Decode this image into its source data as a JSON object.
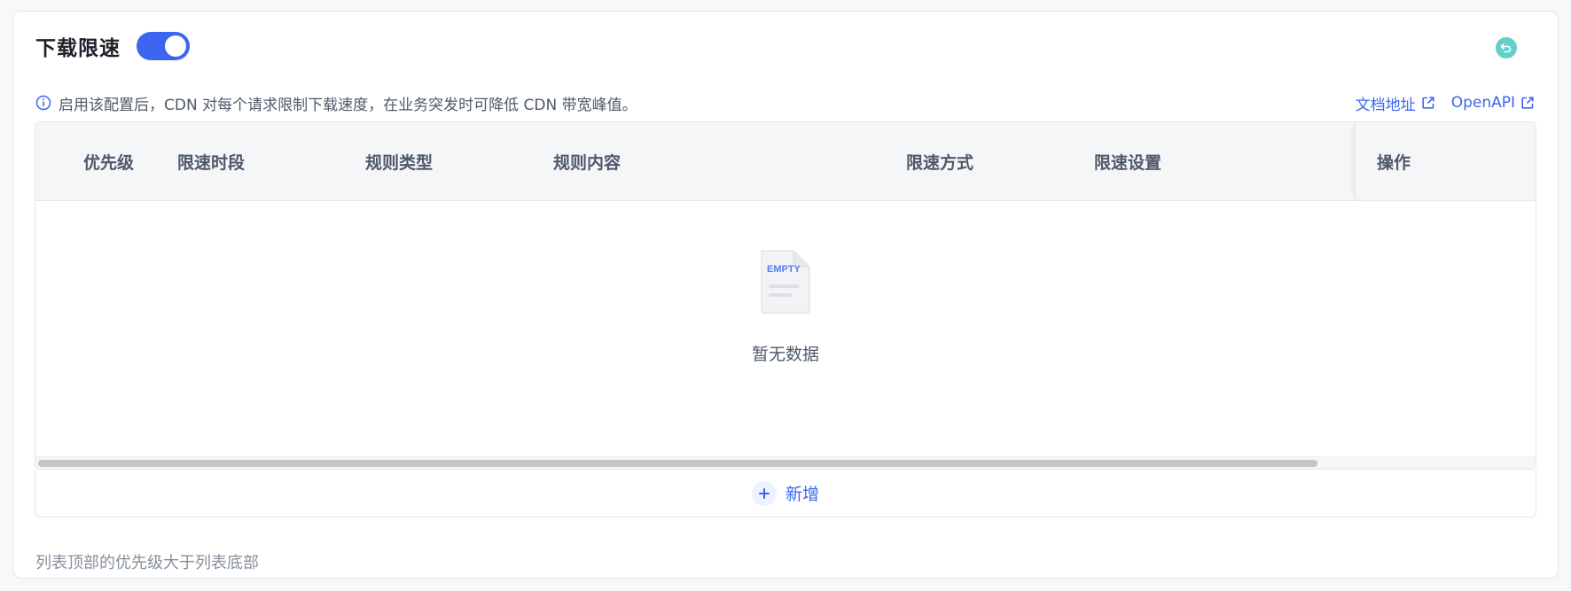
{
  "section": {
    "title": "下载限速",
    "toggle_on": true,
    "info_text": "启用该配置后，CDN 对每个请求限制下载速度，在业务突发时可降低 CDN 带宽峰值。",
    "doc_link": "文档地址",
    "api_link": "OpenAPI"
  },
  "table": {
    "columns": [
      "优先级",
      "限速时段",
      "规则类型",
      "规则内容",
      "限速方式",
      "限速设置",
      "操作"
    ],
    "rows": [],
    "empty_image_label": "EMPTY",
    "empty_text": "暂无数据",
    "add_label": "新增"
  },
  "footnote": "列表顶部的优先级大于列表底部",
  "colors": {
    "accent": "#3c66f0",
    "undo": "#63cfc8"
  }
}
